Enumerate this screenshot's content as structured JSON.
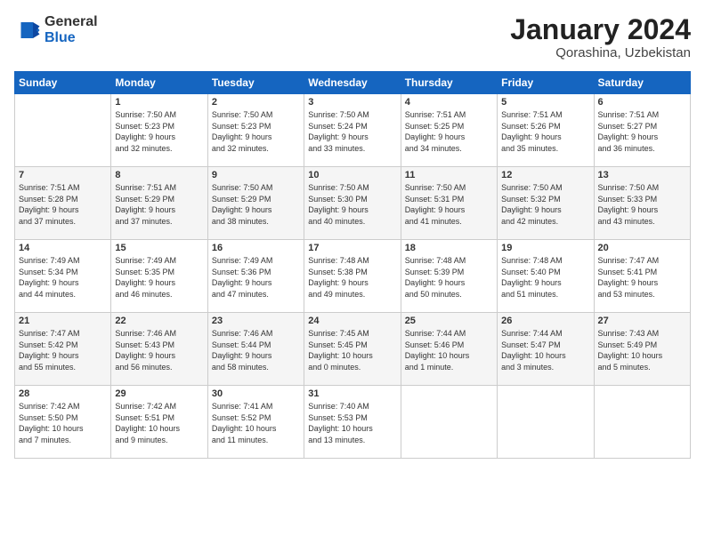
{
  "header": {
    "logo": {
      "general": "General",
      "blue": "Blue"
    },
    "title": "January 2024",
    "location": "Qorashina, Uzbekistan"
  },
  "calendar": {
    "weekdays": [
      "Sunday",
      "Monday",
      "Tuesday",
      "Wednesday",
      "Thursday",
      "Friday",
      "Saturday"
    ],
    "weeks": [
      [
        {
          "day": "",
          "content": ""
        },
        {
          "day": "1",
          "content": "Sunrise: 7:50 AM\nSunset: 5:23 PM\nDaylight: 9 hours\nand 32 minutes."
        },
        {
          "day": "2",
          "content": "Sunrise: 7:50 AM\nSunset: 5:23 PM\nDaylight: 9 hours\nand 32 minutes."
        },
        {
          "day": "3",
          "content": "Sunrise: 7:50 AM\nSunset: 5:24 PM\nDaylight: 9 hours\nand 33 minutes."
        },
        {
          "day": "4",
          "content": "Sunrise: 7:51 AM\nSunset: 5:25 PM\nDaylight: 9 hours\nand 34 minutes."
        },
        {
          "day": "5",
          "content": "Sunrise: 7:51 AM\nSunset: 5:26 PM\nDaylight: 9 hours\nand 35 minutes."
        },
        {
          "day": "6",
          "content": "Sunrise: 7:51 AM\nSunset: 5:27 PM\nDaylight: 9 hours\nand 36 minutes."
        }
      ],
      [
        {
          "day": "7",
          "content": "Sunrise: 7:51 AM\nSunset: 5:28 PM\nDaylight: 9 hours\nand 37 minutes."
        },
        {
          "day": "8",
          "content": "Sunrise: 7:51 AM\nSunset: 5:29 PM\nDaylight: 9 hours\nand 37 minutes."
        },
        {
          "day": "9",
          "content": "Sunrise: 7:50 AM\nSunset: 5:29 PM\nDaylight: 9 hours\nand 38 minutes."
        },
        {
          "day": "10",
          "content": "Sunrise: 7:50 AM\nSunset: 5:30 PM\nDaylight: 9 hours\nand 40 minutes."
        },
        {
          "day": "11",
          "content": "Sunrise: 7:50 AM\nSunset: 5:31 PM\nDaylight: 9 hours\nand 41 minutes."
        },
        {
          "day": "12",
          "content": "Sunrise: 7:50 AM\nSunset: 5:32 PM\nDaylight: 9 hours\nand 42 minutes."
        },
        {
          "day": "13",
          "content": "Sunrise: 7:50 AM\nSunset: 5:33 PM\nDaylight: 9 hours\nand 43 minutes."
        }
      ],
      [
        {
          "day": "14",
          "content": "Sunrise: 7:49 AM\nSunset: 5:34 PM\nDaylight: 9 hours\nand 44 minutes."
        },
        {
          "day": "15",
          "content": "Sunrise: 7:49 AM\nSunset: 5:35 PM\nDaylight: 9 hours\nand 46 minutes."
        },
        {
          "day": "16",
          "content": "Sunrise: 7:49 AM\nSunset: 5:36 PM\nDaylight: 9 hours\nand 47 minutes."
        },
        {
          "day": "17",
          "content": "Sunrise: 7:48 AM\nSunset: 5:38 PM\nDaylight: 9 hours\nand 49 minutes."
        },
        {
          "day": "18",
          "content": "Sunrise: 7:48 AM\nSunset: 5:39 PM\nDaylight: 9 hours\nand 50 minutes."
        },
        {
          "day": "19",
          "content": "Sunrise: 7:48 AM\nSunset: 5:40 PM\nDaylight: 9 hours\nand 51 minutes."
        },
        {
          "day": "20",
          "content": "Sunrise: 7:47 AM\nSunset: 5:41 PM\nDaylight: 9 hours\nand 53 minutes."
        }
      ],
      [
        {
          "day": "21",
          "content": "Sunrise: 7:47 AM\nSunset: 5:42 PM\nDaylight: 9 hours\nand 55 minutes."
        },
        {
          "day": "22",
          "content": "Sunrise: 7:46 AM\nSunset: 5:43 PM\nDaylight: 9 hours\nand 56 minutes."
        },
        {
          "day": "23",
          "content": "Sunrise: 7:46 AM\nSunset: 5:44 PM\nDaylight: 9 hours\nand 58 minutes."
        },
        {
          "day": "24",
          "content": "Sunrise: 7:45 AM\nSunset: 5:45 PM\nDaylight: 10 hours\nand 0 minutes."
        },
        {
          "day": "25",
          "content": "Sunrise: 7:44 AM\nSunset: 5:46 PM\nDaylight: 10 hours\nand 1 minute."
        },
        {
          "day": "26",
          "content": "Sunrise: 7:44 AM\nSunset: 5:47 PM\nDaylight: 10 hours\nand 3 minutes."
        },
        {
          "day": "27",
          "content": "Sunrise: 7:43 AM\nSunset: 5:49 PM\nDaylight: 10 hours\nand 5 minutes."
        }
      ],
      [
        {
          "day": "28",
          "content": "Sunrise: 7:42 AM\nSunset: 5:50 PM\nDaylight: 10 hours\nand 7 minutes."
        },
        {
          "day": "29",
          "content": "Sunrise: 7:42 AM\nSunset: 5:51 PM\nDaylight: 10 hours\nand 9 minutes."
        },
        {
          "day": "30",
          "content": "Sunrise: 7:41 AM\nSunset: 5:52 PM\nDaylight: 10 hours\nand 11 minutes."
        },
        {
          "day": "31",
          "content": "Sunrise: 7:40 AM\nSunset: 5:53 PM\nDaylight: 10 hours\nand 13 minutes."
        },
        {
          "day": "",
          "content": ""
        },
        {
          "day": "",
          "content": ""
        },
        {
          "day": "",
          "content": ""
        }
      ]
    ]
  }
}
